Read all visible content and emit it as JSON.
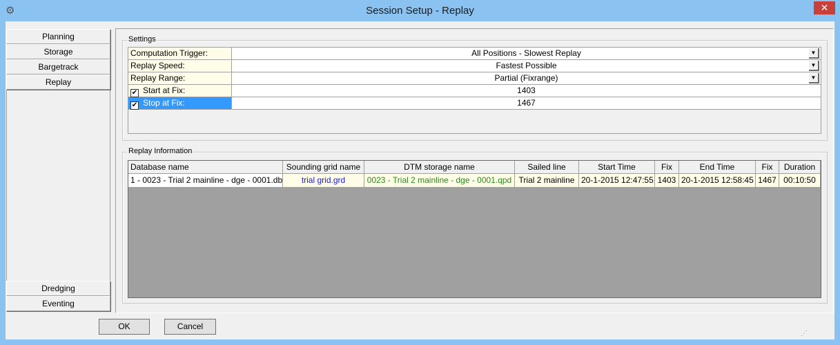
{
  "window": {
    "title": "Session Setup - Replay",
    "close": "✕",
    "icon": "gear-icon"
  },
  "nav": {
    "top": [
      "Planning",
      "Storage",
      "Bargetrack",
      "Replay"
    ],
    "bottom": [
      "Dredging",
      "Eventing"
    ]
  },
  "settings": {
    "group_label": "Settings",
    "rows": [
      {
        "label": "Computation Trigger:",
        "value": "All Positions - Slowest Replay",
        "dropdown": true
      },
      {
        "label": "Replay Speed:",
        "value": "Fastest Possible",
        "dropdown": true
      },
      {
        "label": "Replay Range:",
        "value": "Partial (Fixrange)",
        "dropdown": true
      },
      {
        "label": "Start at Fix:",
        "value": "1403",
        "checked": true
      },
      {
        "label": "Stop at Fix:",
        "value": "1467",
        "checked": true,
        "selected": true
      }
    ],
    "check": "✔"
  },
  "replay_info": {
    "group_label": "Replay Information",
    "columns": [
      "Database name",
      "Sounding grid name",
      "DTM storage name",
      "Sailed line",
      "Start Time",
      "Fix",
      "End Time",
      "Fix",
      "Duration"
    ],
    "rows": [
      [
        "1 - 0023 - Trial 2 mainline - dge - 0001.db",
        "trial grid.grd",
        "0023 - Trial 2 mainline - dge - 0001.qpd",
        "Trial 2 mainline",
        "20-1-2015 12:47:55",
        "1403",
        "20-1-2015 12:58:45",
        "1467",
        "00:10:50"
      ]
    ],
    "colors": {
      "grid": "#1a1ad0",
      "dtm": "#2a8a1a"
    }
  },
  "buttons": {
    "ok": "OK",
    "cancel": "Cancel"
  }
}
